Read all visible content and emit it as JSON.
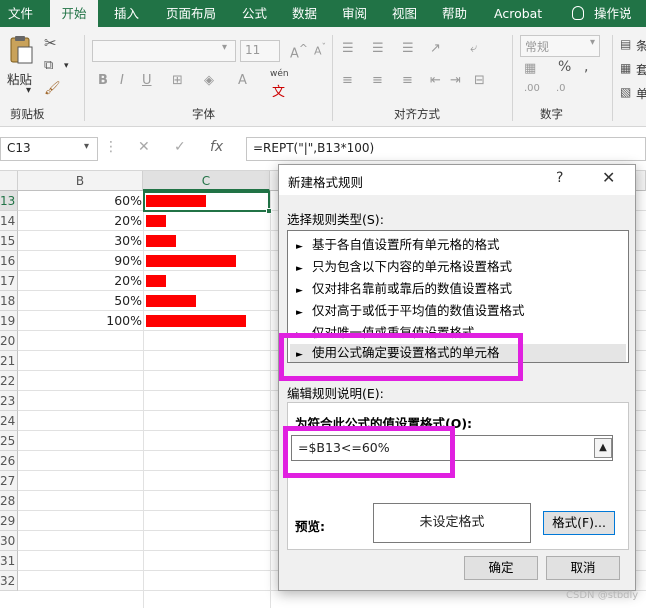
{
  "ribbon": {
    "tabs": [
      "文件",
      "开始",
      "插入",
      "页面布局",
      "公式",
      "数据",
      "审阅",
      "视图",
      "帮助",
      "Acrobat",
      "操作说明"
    ],
    "active_tab": "开始",
    "groups": {
      "clipboard": "剪贴板",
      "font": "字体",
      "alignment": "对齐方式",
      "number": "数字"
    },
    "paste_label": "粘贴",
    "font_size": "11",
    "number_format": "常规",
    "wen_label": "wén",
    "percent_symbol": "%",
    "comma_symbol": ",",
    "styles_partial": [
      "条",
      "套",
      "单"
    ]
  },
  "formula_bar": {
    "name_box": "C13",
    "fx_label": "fx",
    "formula": "=REPT(\"|\",B13*100)"
  },
  "sheet": {
    "columns": [
      "B",
      "C"
    ],
    "rows": [
      "13",
      "14",
      "15",
      "16",
      "17",
      "18",
      "19",
      "20",
      "21",
      "22",
      "23",
      "24",
      "25",
      "26",
      "27",
      "28",
      "29",
      "30",
      "31",
      "32"
    ],
    "values": [
      {
        "label": "60%",
        "fraction": 0.6
      },
      {
        "label": "20%",
        "fraction": 0.2
      },
      {
        "label": "30%",
        "fraction": 0.3
      },
      {
        "label": "90%",
        "fraction": 0.9
      },
      {
        "label": "20%",
        "fraction": 0.2
      },
      {
        "label": "50%",
        "fraction": 0.5
      },
      {
        "label": "100%",
        "fraction": 1.0
      }
    ]
  },
  "dialog": {
    "title": "新建格式规则",
    "help": "?",
    "close": "✕",
    "select_rule_type_label": "选择规则类型(S):",
    "rule_types": [
      "基于各自值设置所有单元格的格式",
      "只为包含以下内容的单元格设置格式",
      "仅对排名靠前或靠后的数值设置格式",
      "仅对高于或低于平均值的数值设置格式",
      "仅对唯一值或重复值设置格式",
      "使用公式确定要设置格式的单元格"
    ],
    "selected_rule_index": 5,
    "edit_rule_label": "编辑规则说明(E):",
    "formula_label": "为符合此公式的值设置格式(O):",
    "formula_value": "=$B13<=60%",
    "preview_label": "预览:",
    "preview_text": "未设定格式",
    "format_button": "格式(F)...",
    "ok_button": "确定",
    "cancel_button": "取消"
  },
  "highlight_color": "#e020e0",
  "accent_color": "#217346",
  "watermark": "CSDN @stbdly"
}
